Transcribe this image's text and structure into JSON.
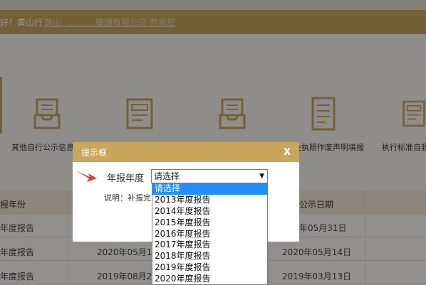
{
  "header": {
    "welcome": "好！黄山行",
    "welcome_obscured": "黄山…………管理有限公司  恭喜您"
  },
  "tiles": [
    {
      "label": "其他自行公示信息填",
      "icon": "tray-icon"
    },
    {
      "label": "",
      "icon": "report-icon"
    },
    {
      "label": "",
      "icon": "tray-icon"
    },
    {
      "label": "业执照作废声明填报",
      "icon": "document-icon"
    },
    {
      "label": "执行标准自我",
      "icon": "report-icon"
    }
  ],
  "table": {
    "headers": [
      "报年份",
      "",
      "公示日期"
    ],
    "rows": [
      {
        "year": "年度报告",
        "date": "",
        "publish": "年05月31日"
      },
      {
        "year": "年度报告",
        "date": "2020年05月14",
        "publish": "2020年05月14日"
      },
      {
        "year": "年度报告",
        "date": "2019年08月25",
        "publish": "2019年03月13日"
      }
    ]
  },
  "modal": {
    "title": "提示框",
    "close": "X",
    "field_label": "年报年度",
    "select_value": "请选择",
    "note": "说明：补报完"
  },
  "dropdown": {
    "options": [
      "请选择",
      "2013年度报告",
      "2014年度报告",
      "2015年度报告",
      "2016年度报告",
      "2017年度报告",
      "2018年度报告",
      "2019年度报告",
      "2020年度报告"
    ],
    "selected_index": 0
  },
  "colors": {
    "accent": "#c9a65c",
    "highlight": "#1e90ff",
    "arrow": "#e53935"
  }
}
